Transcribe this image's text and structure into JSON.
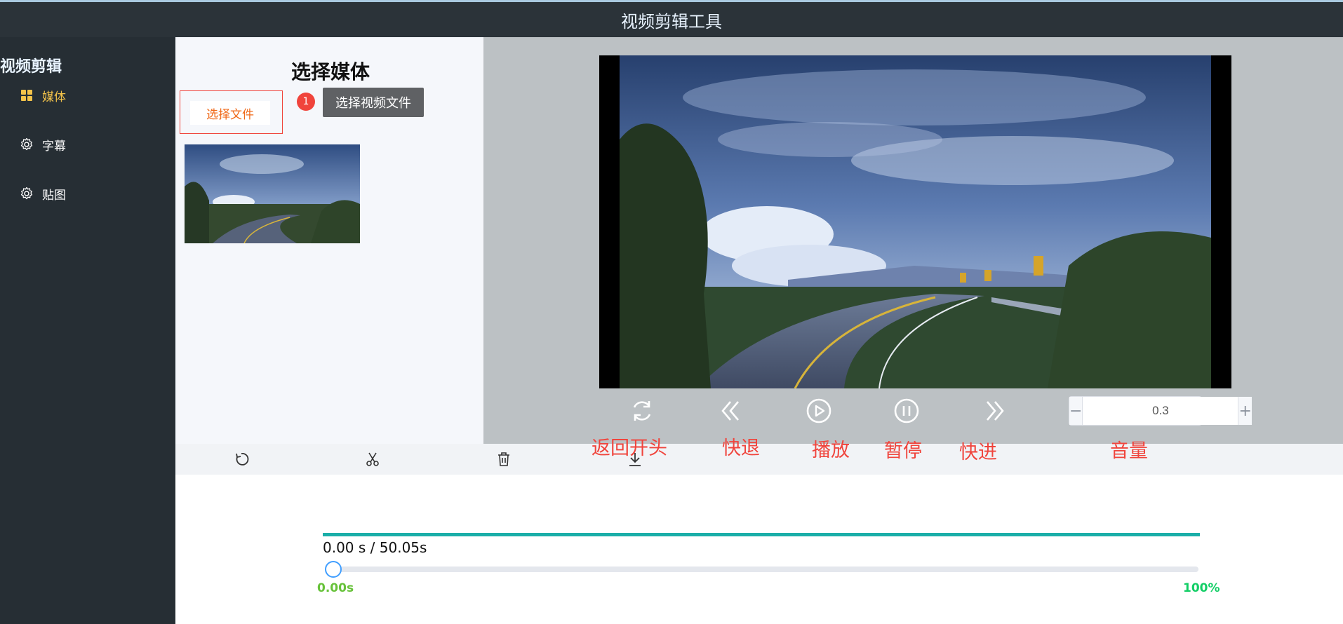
{
  "app": {
    "title": "视频剪辑工具"
  },
  "sidebar": {
    "brand": "视频剪辑",
    "items": [
      {
        "label": "媒体",
        "icon": "grid-icon",
        "active": true
      },
      {
        "label": "字幕",
        "icon": "gear-icon",
        "active": false
      },
      {
        "label": "贴图",
        "icon": "gear-icon",
        "active": false
      }
    ]
  },
  "media": {
    "title": "选择媒体",
    "select_file_label": "选择文件",
    "badge": "1",
    "tooltip": "选择视频文件"
  },
  "controls": {
    "rewind_to_start": "返回开头",
    "back": "快退",
    "play": "播放",
    "pause": "暂停",
    "forward": "快进",
    "volume": "音量",
    "volume_value": "0.3",
    "minus": "−",
    "plus": "+"
  },
  "timeline": {
    "time_text": "0.00 s / 50.05s",
    "start_label": "0.00s",
    "end_label": "100%",
    "progress": 0
  },
  "colors": {
    "accent_teal": "#1aaea8",
    "annotation_red": "#f0443c",
    "active_nav": "#f3c34a",
    "slider_blue": "#409eff"
  }
}
